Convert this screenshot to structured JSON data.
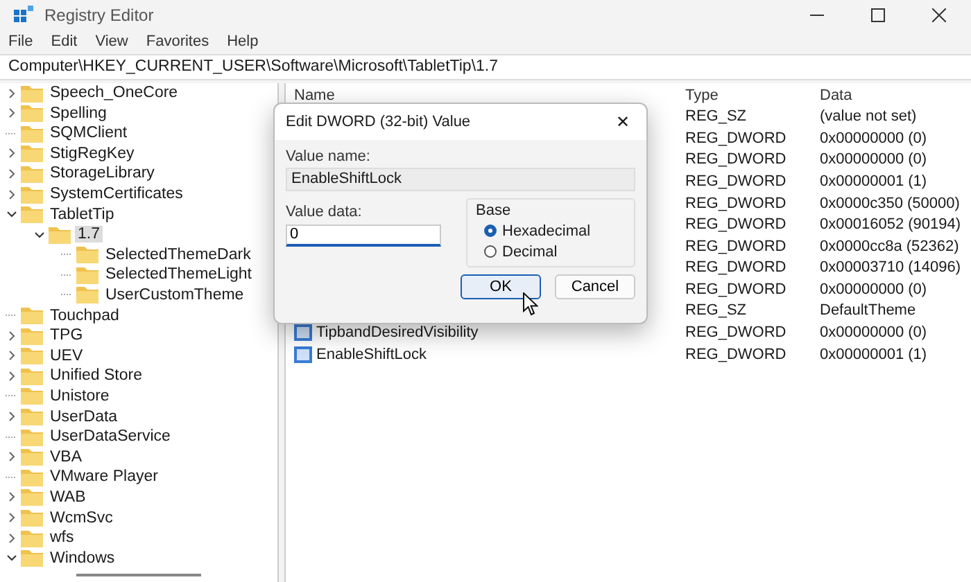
{
  "window": {
    "title": "Registry Editor"
  },
  "menu": [
    "File",
    "Edit",
    "View",
    "Favorites",
    "Help"
  ],
  "address": "Computer\\HKEY_CURRENT_USER\\Software\\Microsoft\\TabletTip\\1.7",
  "tree": {
    "items": [
      {
        "label": "Speech_OneCore",
        "kind": "branch",
        "expanded": false,
        "selected": false
      },
      {
        "label": "Spelling",
        "kind": "branch",
        "expanded": false,
        "selected": false
      },
      {
        "label": "SQMClient",
        "kind": "leaf",
        "selected": false
      },
      {
        "label": "StigRegKey",
        "kind": "branch",
        "expanded": false,
        "selected": false
      },
      {
        "label": "StorageLibrary",
        "kind": "branch",
        "expanded": false,
        "selected": false
      },
      {
        "label": "SystemCertificates",
        "kind": "branch",
        "expanded": false,
        "selected": false
      },
      {
        "label": "TabletTip",
        "kind": "branch",
        "expanded": true,
        "selected": false,
        "children": [
          {
            "label": "1.7",
            "kind": "branch",
            "expanded": true,
            "selected": true,
            "children": [
              {
                "label": "SelectedThemeDark",
                "kind": "leaf",
                "selected": false
              },
              {
                "label": "SelectedThemeLight",
                "kind": "leaf",
                "selected": false
              },
              {
                "label": "UserCustomTheme",
                "kind": "leaf",
                "selected": false
              }
            ]
          }
        ]
      },
      {
        "label": "Touchpad",
        "kind": "leaf",
        "selected": false
      },
      {
        "label": "TPG",
        "kind": "branch",
        "expanded": false,
        "selected": false
      },
      {
        "label": "UEV",
        "kind": "branch",
        "expanded": false,
        "selected": false
      },
      {
        "label": "Unified Store",
        "kind": "branch",
        "expanded": false,
        "selected": false
      },
      {
        "label": "Unistore",
        "kind": "leaf",
        "selected": false
      },
      {
        "label": "UserData",
        "kind": "branch",
        "expanded": false,
        "selected": false
      },
      {
        "label": "UserDataService",
        "kind": "leaf",
        "selected": false
      },
      {
        "label": "VBA",
        "kind": "branch",
        "expanded": false,
        "selected": false
      },
      {
        "label": "VMware Player",
        "kind": "leaf",
        "selected": false
      },
      {
        "label": "WAB",
        "kind": "branch",
        "expanded": false,
        "selected": false
      },
      {
        "label": "WcmSvc",
        "kind": "branch",
        "expanded": false,
        "selected": false
      },
      {
        "label": "wfs",
        "kind": "branch",
        "expanded": false,
        "selected": false
      },
      {
        "label": "Windows",
        "kind": "branch",
        "expanded": true,
        "selected": false
      }
    ]
  },
  "values": {
    "columns": [
      "Name",
      "Type",
      "Data"
    ],
    "rows": [
      {
        "type": "REG_SZ",
        "data": "(value not set)"
      },
      {
        "type": "REG_DWORD",
        "data": "0x00000000 (0)"
      },
      {
        "type": "REG_DWORD",
        "data": "0x00000000 (0)"
      },
      {
        "type": "REG_DWORD",
        "data": "0x00000001 (1)"
      },
      {
        "type": "REG_DWORD",
        "data": "0x0000c350 (50000)"
      },
      {
        "type": "REG_DWORD",
        "data": "0x00016052 (90194)"
      },
      {
        "type": "REG_DWORD",
        "data": "0x0000cc8a (52362)"
      },
      {
        "type": "REG_DWORD",
        "data": "0x00003710 (14096)"
      },
      {
        "type": "REG_DWORD",
        "data": "0x00000000 (0)"
      },
      {
        "type": "REG_SZ",
        "data": "DefaultTheme"
      },
      {
        "name": "TipbandDesiredVisibility",
        "type": "REG_DWORD",
        "data": "0x00000000 (0)"
      },
      {
        "name": "EnableShiftLock",
        "type": "REG_DWORD",
        "data": "0x00000001 (1)"
      }
    ]
  },
  "dialog": {
    "title": "Edit DWORD (32-bit) Value",
    "close": "✕",
    "name_label": "Value name:",
    "name_value": "EnableShiftLock",
    "data_label": "Value data:",
    "data_value": "0",
    "base_label": "Base",
    "radios": [
      {
        "label": "Hexadecimal",
        "selected": true
      },
      {
        "label": "Decimal",
        "selected": false
      }
    ],
    "buttons": [
      {
        "label": "OK",
        "focused": true
      },
      {
        "label": "Cancel",
        "focused": false
      }
    ]
  }
}
